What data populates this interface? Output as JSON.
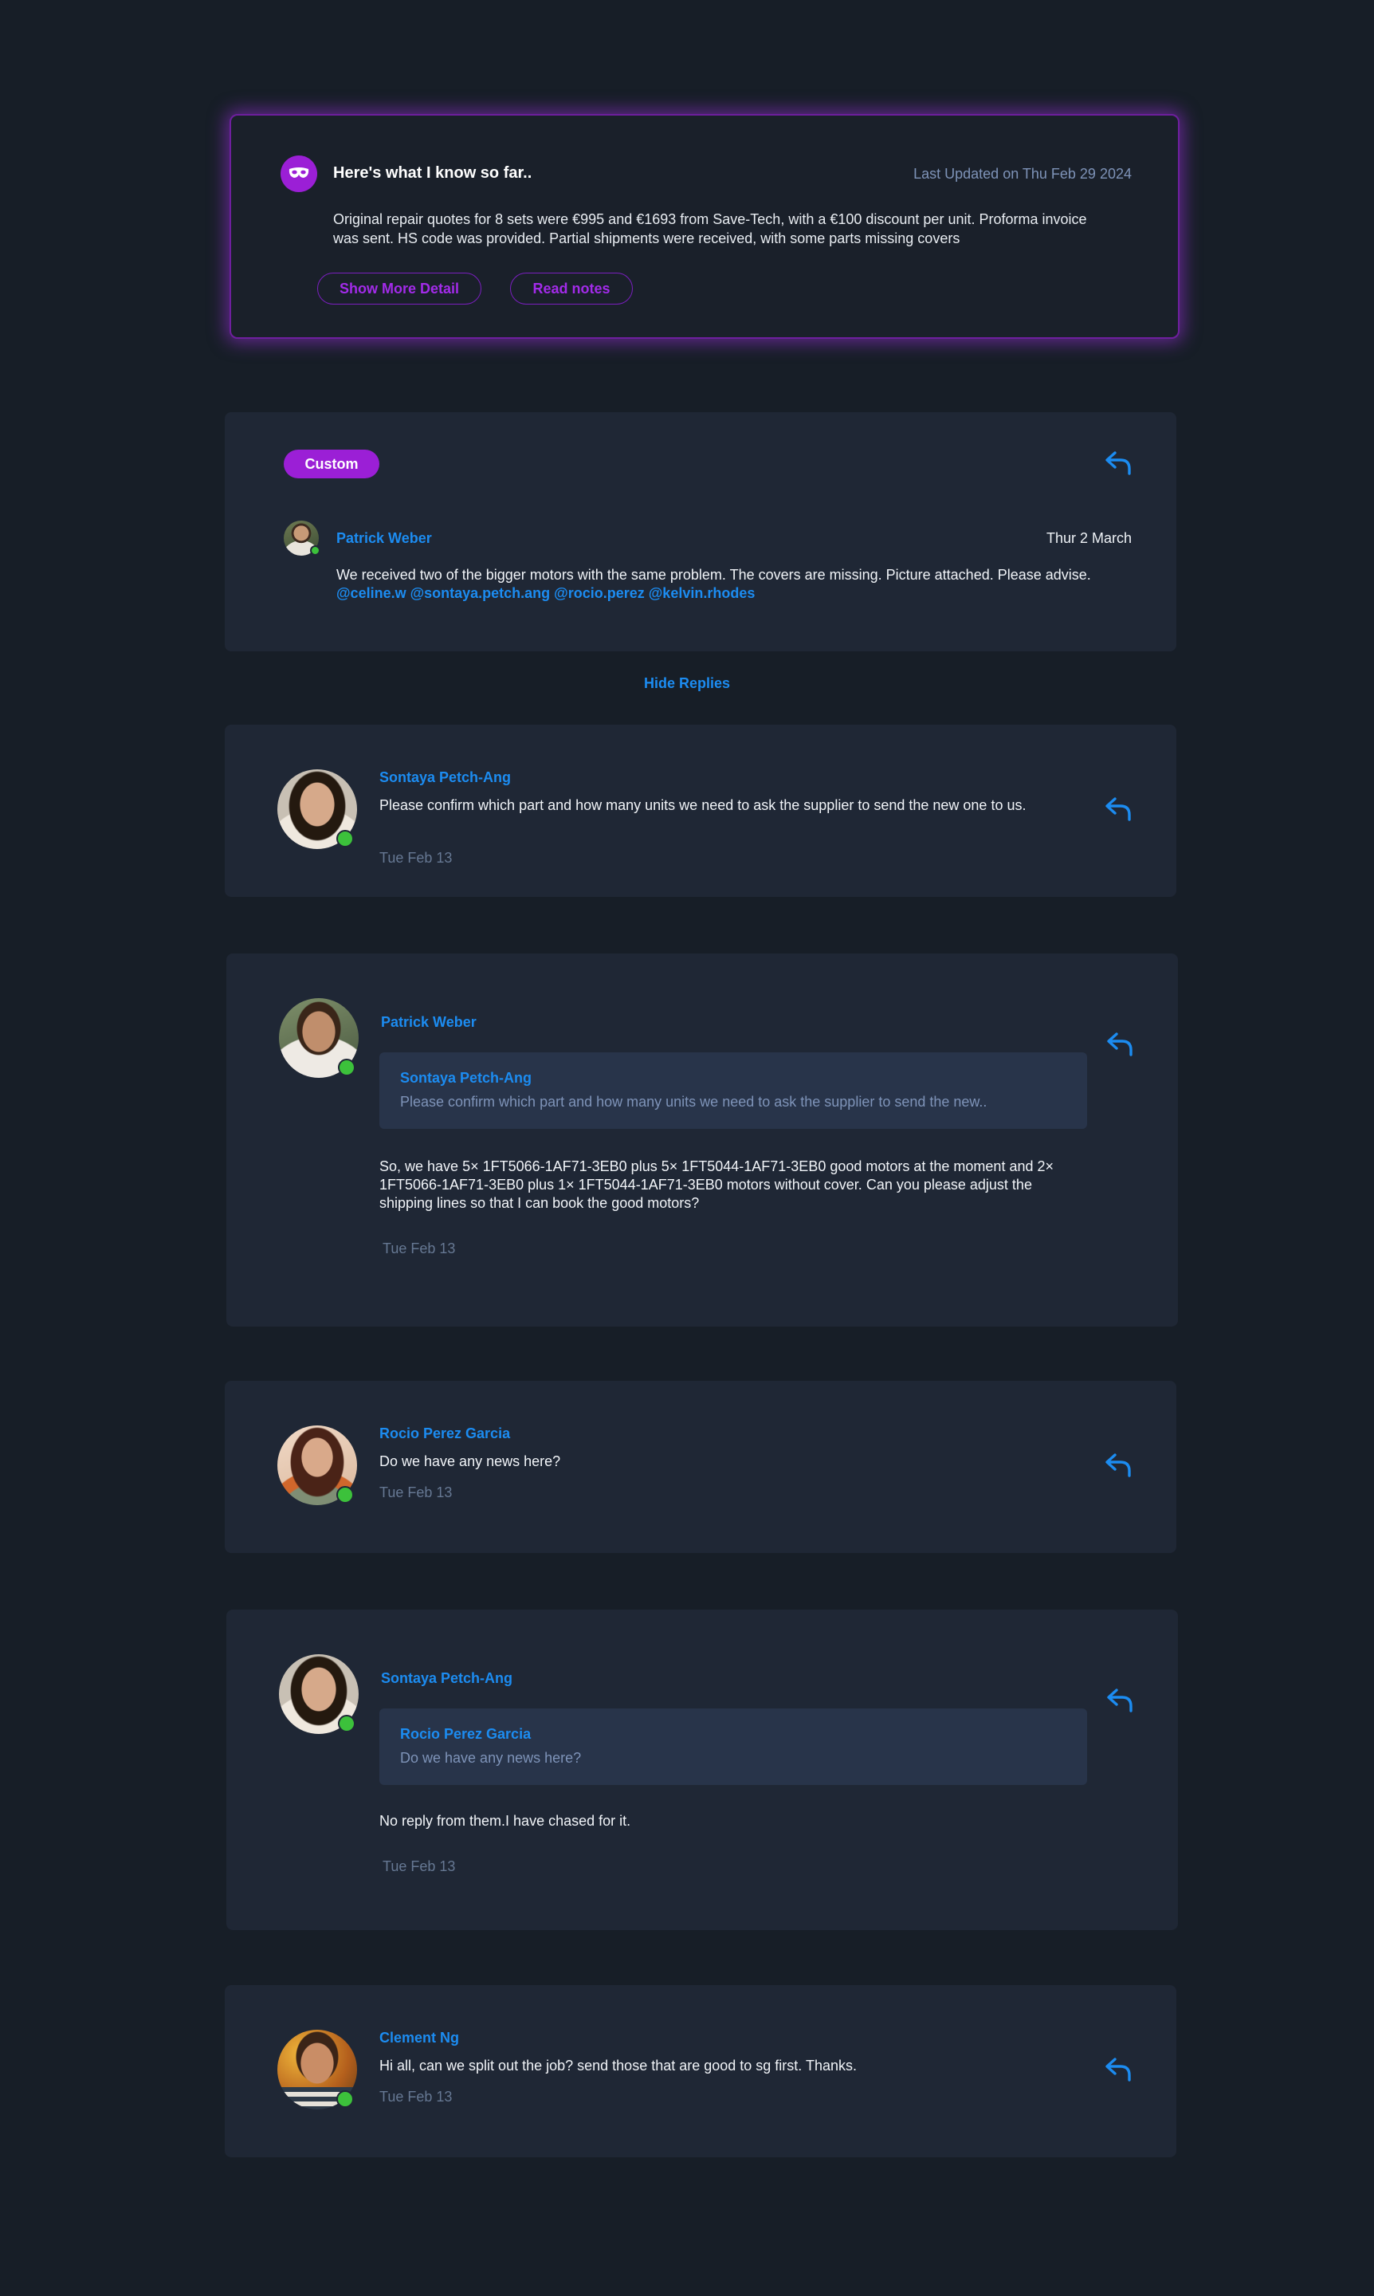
{
  "summary": {
    "title": "Here's what I know so far..",
    "updated": "Last Updated on Thu Feb 29 2024",
    "text": "Original repair quotes for 8 sets were €995 and €1693 from Save-Tech, with a €100 discount per unit. Proforma invoice was sent. HS code was provided. Partial shipments were received, with some parts missing covers",
    "show_more_label": "Show More Detail",
    "read_notes_label": "Read notes"
  },
  "thread": {
    "tag": "Custom",
    "author": "Patrick Weber",
    "date": "Thur 2 March",
    "text": "We received two of the bigger motors with the same problem. The covers are missing. Picture attached. Please advise.",
    "mentions": "@celine.w @sontaya.petch.ang @rocio.perez @kelvin.rhodes"
  },
  "hide_replies_label": "Hide Replies",
  "replies": [
    {
      "author": "Sontaya Petch-Ang",
      "text": "Please confirm which part and how many units we need to ask the supplier to send the new one to us.",
      "date": "Tue Feb 13"
    },
    {
      "author": "Patrick Weber",
      "quote_author": "Sontaya Petch-Ang",
      "quote_text": "Please confirm which part and how many units we need to ask the supplier to send the new..",
      "text": "So, we have 5× 1FT5066-1AF71-3EB0 plus 5× 1FT5044-1AF71-3EB0 good motors at the moment and 2× 1FT5066-1AF71-3EB0 plus 1× 1FT5044-1AF71-3EB0 motors without cover. Can you please adjust the shipping lines so that I can book the good motors?",
      "date": "Tue Feb 13"
    },
    {
      "author": "Rocio Perez Garcia",
      "text": "Do we have any news here?",
      "date": "Tue Feb 13"
    },
    {
      "author": "Sontaya Petch-Ang",
      "quote_author": "Rocio Perez Garcia",
      "quote_text": "Do we have any news here?",
      "text": "No reply from them.I have chased for it.",
      "date": "Tue Feb 13"
    },
    {
      "author": "Clement Ng",
      "text": "Hi all, can we split out the job? send those that are good to sg first. Thanks.",
      "date": "Tue Feb 13"
    }
  ],
  "icons": {
    "bot": "mask-icon",
    "reply": "reply-arrow-icon"
  },
  "colors": {
    "background": "#171e27",
    "card": "#1f2735",
    "accent_purple": "#9b1fd6",
    "link_blue": "#1c8cf1",
    "online_green": "#3cc13b"
  }
}
